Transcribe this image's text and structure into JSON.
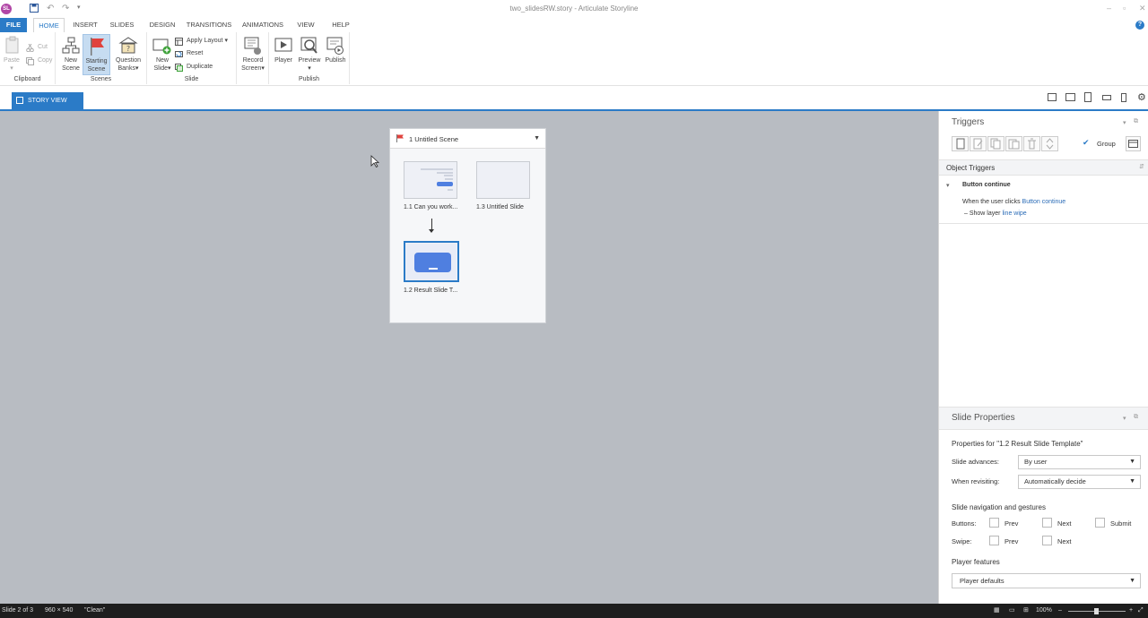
{
  "window": {
    "title": "two_slidesRW.story - Articulate Storyline",
    "app_logo": "SL",
    "colors": {
      "accent": "#2b7bc7",
      "canvas": "#b8bcc2",
      "logo": "#b146a6"
    }
  },
  "quick_access": {
    "icons": [
      "save-icon",
      "undo-icon",
      "redo-icon",
      "customize-icon"
    ]
  },
  "menu": {
    "file": "FILE",
    "tabs": [
      "HOME",
      "INSERT",
      "SLIDES",
      "DESIGN",
      "TRANSITIONS",
      "ANIMATIONS",
      "VIEW",
      "HELP"
    ],
    "active_tab": "HOME"
  },
  "ribbon": {
    "clipboard": {
      "label": "Clipboard",
      "paste": "Paste",
      "cut": "Cut",
      "copy": "Copy"
    },
    "scenes": {
      "label": "Scenes",
      "new_scene": [
        "New",
        "Scene"
      ],
      "starting_scene": [
        "Starting",
        "Scene"
      ],
      "question_banks": [
        "Question",
        "Banks"
      ]
    },
    "slide": {
      "label": "Slide",
      "new_slide": [
        "New",
        "Slide"
      ],
      "apply_layout": "Apply Layout",
      "reset": "Reset",
      "duplicate": "Duplicate"
    },
    "record": {
      "record_screen": [
        "Record",
        "Screen"
      ]
    },
    "publish": {
      "label": "Publish",
      "player": "Player",
      "preview": "Preview",
      "publish": "Publish"
    }
  },
  "view_tab": {
    "label": "STORY VIEW"
  },
  "scene": {
    "title": "1 Untitled Scene",
    "slides": [
      {
        "label": "1.1 Can you work...",
        "selected": false
      },
      {
        "label": "1.3 Untitled Slide",
        "selected": false
      },
      {
        "label": "1.2 Result Slide T...",
        "selected": true
      }
    ]
  },
  "triggers": {
    "title": "Triggers",
    "group_label": "Group",
    "group_checked": true,
    "object_triggers": "Object Triggers",
    "object_name": "Button continue",
    "when_prefix": "When the user clicks",
    "when_object": "Button continue",
    "action_prefix": "Show layer",
    "action_target": "line wipe"
  },
  "slide_properties": {
    "title": "Slide Properties",
    "properties_for": "Properties for \"1.2 Result Slide Template\"",
    "slide_advances_label": "Slide advances:",
    "slide_advances_value": "By user",
    "when_revisiting_label": "When revisiting:",
    "when_revisiting_value": "Automatically decide",
    "nav_heading": "Slide navigation and gestures",
    "buttons_label": "Buttons:",
    "swipe_label": "Swipe:",
    "prev": "Prev",
    "next": "Next",
    "submit": "Submit",
    "player_features": "Player features",
    "player_defaults": "Player defaults"
  },
  "status": {
    "slide": "Slide 2 of 3",
    "size": "960 × 540",
    "state": "\"Clean\"",
    "zoom": "100%"
  }
}
